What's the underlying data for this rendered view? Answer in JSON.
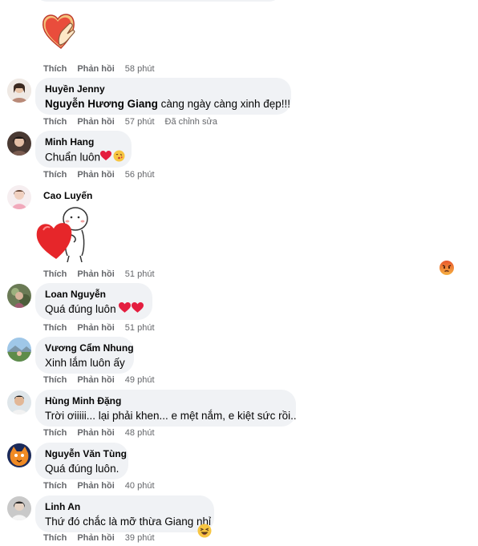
{
  "actions": {
    "like": "Thích",
    "reply": "Phản hồi",
    "edited": "Đã chỉnh sửa"
  },
  "comments": [
    {
      "name": "",
      "text": "",
      "time": "58 phút",
      "sticker": "heart-finger-sticker"
    },
    {
      "name": "Huyền Jenny",
      "mention": "Nguyễn Hương Giang",
      "text": " càng ngày càng xinh đẹp!!!",
      "time": "57 phút",
      "edited": true
    },
    {
      "name": "Minh Hang",
      "text": "Chuẩn luôn",
      "time": "56 phút",
      "emojis": [
        "red-heart-icon",
        "kissing-face-icon"
      ]
    },
    {
      "name": "Cao Luyến",
      "text": "",
      "time": "51 phút",
      "sticker": "hugging-heart-sticker"
    },
    {
      "name": "Loan Nguyễn",
      "text": "Quá đúng luôn ",
      "time": "51 phút",
      "emojis": [
        "red-heart-icon",
        "red-heart-icon"
      ]
    },
    {
      "name": "Vương Cẩm Nhung",
      "text": "Xinh lắm luôn ấy",
      "time": "49 phút"
    },
    {
      "name": "Hùng Minh Đặng",
      "text": "Trời ơiiiii... lại phải khen... e mệt nắm, e kiệt sức rồi..",
      "time": "48 phút"
    },
    {
      "name": "Nguyễn Văn Tùng",
      "text": "Quá đúng luôn.",
      "time": "40 phút"
    },
    {
      "name": "Linh An",
      "text": "Thứ đó chắc là mỡ thừa Giang nhỉ",
      "time": "39 phút",
      "reaction": "haha-icon"
    }
  ],
  "floating_reaction": "angry-face-icon",
  "colors": {
    "bubble": "#f0f2f5",
    "meta": "#65676b",
    "heart": "#e41e3f"
  }
}
